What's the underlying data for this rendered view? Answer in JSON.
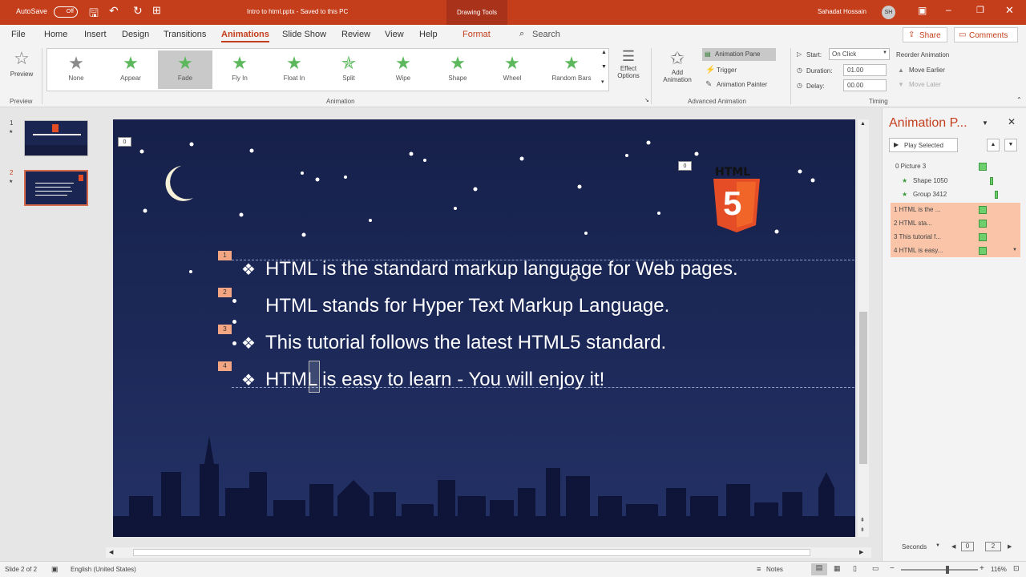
{
  "titlebar": {
    "autosave": "AutoSave",
    "autosave_state": "Off",
    "doc_title": "Intro to html.pptx  -  Saved to this PC",
    "context_tab": "Drawing Tools",
    "user": "Sahadat Hossain",
    "user_initials": "SH"
  },
  "tabs": [
    "File",
    "Home",
    "Insert",
    "Design",
    "Transitions",
    "Animations",
    "Slide Show",
    "Review",
    "View",
    "Help",
    "Format"
  ],
  "search": "Search",
  "share": "Share",
  "comments": "Comments",
  "ribbon": {
    "preview": "Preview",
    "preview_group": "Preview",
    "animations": [
      "None",
      "Appear",
      "Fade",
      "Fly In",
      "Float In",
      "Split",
      "Wipe",
      "Shape",
      "Wheel",
      "Random Bars"
    ],
    "effect_options": "Effect Options",
    "animation_group": "Animation",
    "add_animation": "Add Animation",
    "animation_pane": "Animation Pane",
    "trigger": "Trigger",
    "animation_painter": "Animation Painter",
    "advanced_group": "Advanced Animation",
    "start_label": "Start:",
    "start_value": "On Click",
    "duration_label": "Duration:",
    "duration_value": "01.00",
    "delay_label": "Delay:",
    "delay_value": "00.00",
    "reorder": "Reorder Animation",
    "move_earlier": "Move Earlier",
    "move_later": "Move Later",
    "timing_group": "Timing"
  },
  "thumbs": [
    {
      "num": "1",
      "star": "★"
    },
    {
      "num": "2",
      "star": "★"
    }
  ],
  "slide": {
    "tag_top": "0",
    "tag_html": "0",
    "html_logo_text": "HTML",
    "html_logo_num": "5",
    "bullets": [
      {
        "num": "1",
        "text": "HTML is the standard markup language for Web pages.",
        "mark": "❖"
      },
      {
        "num": "2",
        "text": "HTML stands for Hyper Text Markup Language.",
        "mark": ""
      },
      {
        "num": "3",
        "text": "This tutorial follows the latest HTML5 standard.",
        "mark": "❖"
      },
      {
        "num": "4",
        "text": "HTML is easy to learn - You will enjoy it!",
        "mark": "❖"
      }
    ]
  },
  "pane": {
    "title": "Animation P...",
    "play_selected": "Play Selected",
    "items": [
      {
        "label": "0  Picture 3",
        "hl": false
      },
      {
        "label": "Shape 1050",
        "hl": false
      },
      {
        "label": "Group 3412",
        "hl": false
      },
      {
        "label": "1  HTML is the ...",
        "hl": true
      },
      {
        "label": "2        HTML sta...",
        "hl": true
      },
      {
        "label": "3  This tutorial f...",
        "hl": true
      },
      {
        "label": "4  HTML is easy...",
        "hl": true
      }
    ],
    "seconds": "Seconds",
    "page_a": "0",
    "page_b": "2"
  },
  "status": {
    "slide": "Slide 2 of 2",
    "language": "English (United States)",
    "notes": "Notes",
    "zoom": "116%"
  }
}
